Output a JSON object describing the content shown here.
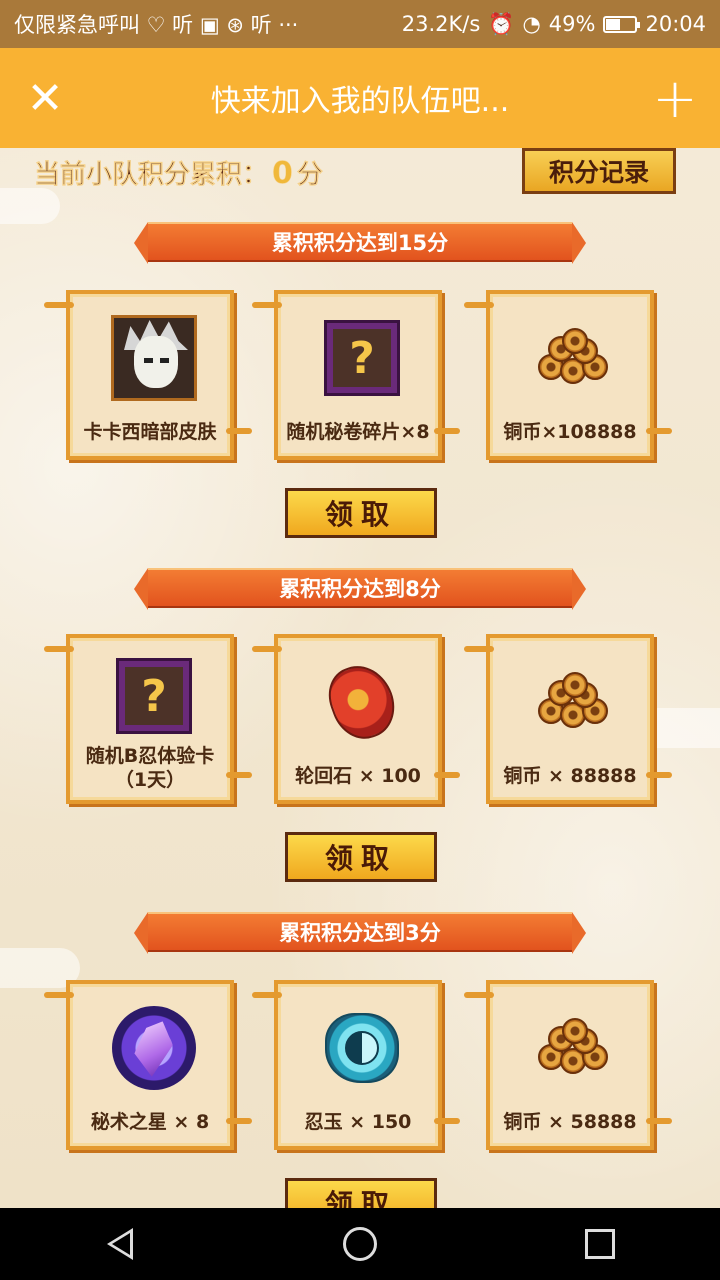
{
  "status_bar": {
    "left_text": "仅限紧急呼叫 ♡ 听 ▣ ⊛ 听 ···",
    "speed": "23.2K/s",
    "battery": "49%",
    "time": "20:04"
  },
  "top_bar": {
    "title": "快来加入我的队伍吧...",
    "close_icon": "close-icon",
    "plus_icon": "plus-icon"
  },
  "score": {
    "label": "当前小队积分累积：",
    "value": "0",
    "unit": "分",
    "record_button": "积分记录"
  },
  "sections": [
    {
      "header": "累积积分达到15分",
      "claim": "领取",
      "rewards": [
        {
          "label": "卡卡西暗部皮肤",
          "icon": "masked-ninja-icon"
        },
        {
          "label": "随机秘卷碎片×8",
          "icon": "scroll-fragment-icon"
        },
        {
          "label": "铜币×108888",
          "icon": "coins-icon"
        }
      ]
    },
    {
      "header": "累积积分达到8分",
      "claim": "领取",
      "rewards": [
        {
          "label": "随机B忍体验卡（1天）",
          "icon": "mystery-ninja-card-icon"
        },
        {
          "label": "轮回石 × 100",
          "icon": "red-stone-icon"
        },
        {
          "label": "铜币 × 88888",
          "icon": "coins-icon"
        }
      ]
    },
    {
      "header": "累积积分达到3分",
      "claim": "领取",
      "rewards": [
        {
          "label": "秘术之星 × 8",
          "icon": "star-crystal-icon"
        },
        {
          "label": "忍玉 × 150",
          "icon": "ninja-jade-icon"
        },
        {
          "label": "铜币 × 58888",
          "icon": "coins-icon"
        }
      ]
    }
  ]
}
